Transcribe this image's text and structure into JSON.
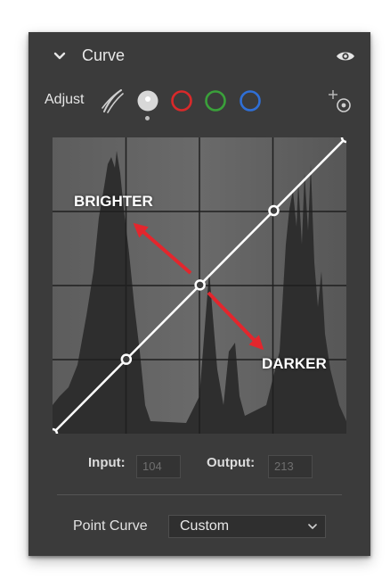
{
  "panel": {
    "title": "Curve",
    "adjust_label": "Adjust"
  },
  "channels": [
    {
      "name": "luminance",
      "color": "#d0d0d0",
      "selected": true
    },
    {
      "name": "red",
      "color": "#d9292a",
      "selected": false
    },
    {
      "name": "green",
      "color": "#3aa03a",
      "selected": false
    },
    {
      "name": "blue",
      "color": "#2f6fd6",
      "selected": false
    }
  ],
  "io": {
    "input_label": "Input:",
    "input_value": "104",
    "output_label": "Output:",
    "output_value": "213"
  },
  "point_curve": {
    "label": "Point Curve",
    "selected": "Custom"
  },
  "annotations": {
    "brighter": "BRIGHTER",
    "darker": "DARKER",
    "arrow_color": "#e3262d"
  },
  "curve_points": [
    {
      "input": 0,
      "output": 0
    },
    {
      "input": 64,
      "output": 64
    },
    {
      "input": 128,
      "output": 128
    },
    {
      "input": 192,
      "output": 192
    },
    {
      "input": 255,
      "output": 255
    }
  ],
  "icons": [
    "chevron-down-icon",
    "eye-icon",
    "brush-icon",
    "add-point-icon",
    "select-arrow-icon"
  ]
}
